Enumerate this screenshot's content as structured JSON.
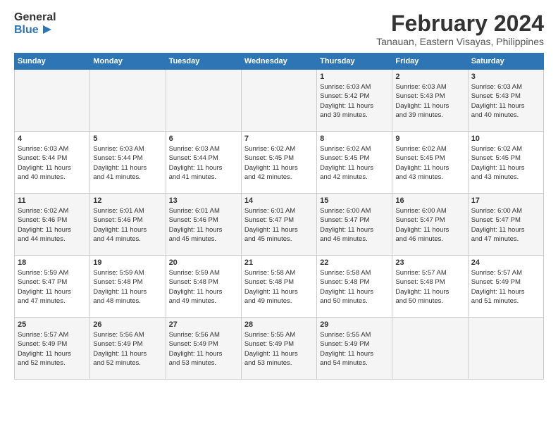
{
  "header": {
    "logo_line1": "General",
    "logo_line2": "Blue",
    "title": "February 2024",
    "subtitle": "Tanauan, Eastern Visayas, Philippines"
  },
  "columns": [
    "Sunday",
    "Monday",
    "Tuesday",
    "Wednesday",
    "Thursday",
    "Friday",
    "Saturday"
  ],
  "weeks": [
    [
      {
        "day": "",
        "lines": []
      },
      {
        "day": "",
        "lines": []
      },
      {
        "day": "",
        "lines": []
      },
      {
        "day": "",
        "lines": []
      },
      {
        "day": "1",
        "lines": [
          "Sunrise: 6:03 AM",
          "Sunset: 5:42 PM",
          "Daylight: 11 hours",
          "and 39 minutes."
        ]
      },
      {
        "day": "2",
        "lines": [
          "Sunrise: 6:03 AM",
          "Sunset: 5:43 PM",
          "Daylight: 11 hours",
          "and 39 minutes."
        ]
      },
      {
        "day": "3",
        "lines": [
          "Sunrise: 6:03 AM",
          "Sunset: 5:43 PM",
          "Daylight: 11 hours",
          "and 40 minutes."
        ]
      }
    ],
    [
      {
        "day": "4",
        "lines": [
          "Sunrise: 6:03 AM",
          "Sunset: 5:44 PM",
          "Daylight: 11 hours",
          "and 40 minutes."
        ]
      },
      {
        "day": "5",
        "lines": [
          "Sunrise: 6:03 AM",
          "Sunset: 5:44 PM",
          "Daylight: 11 hours",
          "and 41 minutes."
        ]
      },
      {
        "day": "6",
        "lines": [
          "Sunrise: 6:03 AM",
          "Sunset: 5:44 PM",
          "Daylight: 11 hours",
          "and 41 minutes."
        ]
      },
      {
        "day": "7",
        "lines": [
          "Sunrise: 6:02 AM",
          "Sunset: 5:45 PM",
          "Daylight: 11 hours",
          "and 42 minutes."
        ]
      },
      {
        "day": "8",
        "lines": [
          "Sunrise: 6:02 AM",
          "Sunset: 5:45 PM",
          "Daylight: 11 hours",
          "and 42 minutes."
        ]
      },
      {
        "day": "9",
        "lines": [
          "Sunrise: 6:02 AM",
          "Sunset: 5:45 PM",
          "Daylight: 11 hours",
          "and 43 minutes."
        ]
      },
      {
        "day": "10",
        "lines": [
          "Sunrise: 6:02 AM",
          "Sunset: 5:45 PM",
          "Daylight: 11 hours",
          "and 43 minutes."
        ]
      }
    ],
    [
      {
        "day": "11",
        "lines": [
          "Sunrise: 6:02 AM",
          "Sunset: 5:46 PM",
          "Daylight: 11 hours",
          "and 44 minutes."
        ]
      },
      {
        "day": "12",
        "lines": [
          "Sunrise: 6:01 AM",
          "Sunset: 5:46 PM",
          "Daylight: 11 hours",
          "and 44 minutes."
        ]
      },
      {
        "day": "13",
        "lines": [
          "Sunrise: 6:01 AM",
          "Sunset: 5:46 PM",
          "Daylight: 11 hours",
          "and 45 minutes."
        ]
      },
      {
        "day": "14",
        "lines": [
          "Sunrise: 6:01 AM",
          "Sunset: 5:47 PM",
          "Daylight: 11 hours",
          "and 45 minutes."
        ]
      },
      {
        "day": "15",
        "lines": [
          "Sunrise: 6:00 AM",
          "Sunset: 5:47 PM",
          "Daylight: 11 hours",
          "and 46 minutes."
        ]
      },
      {
        "day": "16",
        "lines": [
          "Sunrise: 6:00 AM",
          "Sunset: 5:47 PM",
          "Daylight: 11 hours",
          "and 46 minutes."
        ]
      },
      {
        "day": "17",
        "lines": [
          "Sunrise: 6:00 AM",
          "Sunset: 5:47 PM",
          "Daylight: 11 hours",
          "and 47 minutes."
        ]
      }
    ],
    [
      {
        "day": "18",
        "lines": [
          "Sunrise: 5:59 AM",
          "Sunset: 5:47 PM",
          "Daylight: 11 hours",
          "and 47 minutes."
        ]
      },
      {
        "day": "19",
        "lines": [
          "Sunrise: 5:59 AM",
          "Sunset: 5:48 PM",
          "Daylight: 11 hours",
          "and 48 minutes."
        ]
      },
      {
        "day": "20",
        "lines": [
          "Sunrise: 5:59 AM",
          "Sunset: 5:48 PM",
          "Daylight: 11 hours",
          "and 49 minutes."
        ]
      },
      {
        "day": "21",
        "lines": [
          "Sunrise: 5:58 AM",
          "Sunset: 5:48 PM",
          "Daylight: 11 hours",
          "and 49 minutes."
        ]
      },
      {
        "day": "22",
        "lines": [
          "Sunrise: 5:58 AM",
          "Sunset: 5:48 PM",
          "Daylight: 11 hours",
          "and 50 minutes."
        ]
      },
      {
        "day": "23",
        "lines": [
          "Sunrise: 5:57 AM",
          "Sunset: 5:48 PM",
          "Daylight: 11 hours",
          "and 50 minutes."
        ]
      },
      {
        "day": "24",
        "lines": [
          "Sunrise: 5:57 AM",
          "Sunset: 5:49 PM",
          "Daylight: 11 hours",
          "and 51 minutes."
        ]
      }
    ],
    [
      {
        "day": "25",
        "lines": [
          "Sunrise: 5:57 AM",
          "Sunset: 5:49 PM",
          "Daylight: 11 hours",
          "and 52 minutes."
        ]
      },
      {
        "day": "26",
        "lines": [
          "Sunrise: 5:56 AM",
          "Sunset: 5:49 PM",
          "Daylight: 11 hours",
          "and 52 minutes."
        ]
      },
      {
        "day": "27",
        "lines": [
          "Sunrise: 5:56 AM",
          "Sunset: 5:49 PM",
          "Daylight: 11 hours",
          "and 53 minutes."
        ]
      },
      {
        "day": "28",
        "lines": [
          "Sunrise: 5:55 AM",
          "Sunset: 5:49 PM",
          "Daylight: 11 hours",
          "and 53 minutes."
        ]
      },
      {
        "day": "29",
        "lines": [
          "Sunrise: 5:55 AM",
          "Sunset: 5:49 PM",
          "Daylight: 11 hours",
          "and 54 minutes."
        ]
      },
      {
        "day": "",
        "lines": []
      },
      {
        "day": "",
        "lines": []
      }
    ]
  ]
}
